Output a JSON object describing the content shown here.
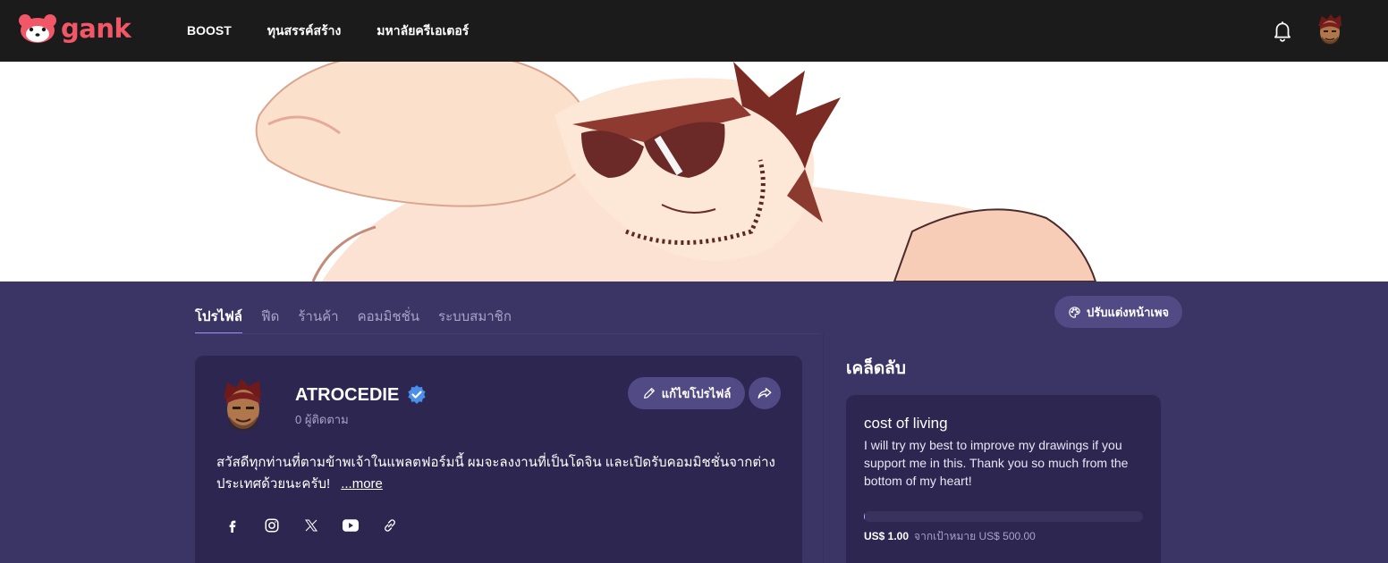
{
  "brand": {
    "name": "gank",
    "color": "#f25767"
  },
  "nav": {
    "items": [
      "BOOST",
      "ทุนสรรค์สร้าง",
      "มหาลัยครีเอเตอร์"
    ]
  },
  "profile_tabs": {
    "items": [
      "โปรไฟล์",
      "ฟีด",
      "ร้านค้า",
      "คอมมิชชั่น",
      "ระบบสมาชิก"
    ],
    "active_index": 0
  },
  "customize_button": {
    "label": "ปรับแต่งหน้าเพจ",
    "icon": "palette-icon"
  },
  "profile": {
    "name": "ATROCEDIE",
    "verified": true,
    "followers": "0 ผู้ติดตาม",
    "edit_label": "แก้ไขโปรไฟล์",
    "bio_line1": "สวัสดีทุกท่านที่ตามข้าพเจ้าในแพลตฟอร์มนี้ ผมจะลงงานที่เป็นโดจิน และเปิดรับคอมมิชชั่นจากต่าง",
    "bio_line2": "ประเทศด้วยนะครับ!",
    "more_label": "...more",
    "socials": [
      "facebook-icon",
      "instagram-icon",
      "x-icon",
      "youtube-icon",
      "link-icon"
    ]
  },
  "secret_section": {
    "title": "เคล็ดลับ",
    "goal": {
      "title": "cost of living",
      "description": "I will try my best to improve my drawings if you support me in this. Thank you so much from the bottom of my heart!",
      "current": "US$ 1.00",
      "target": "จากเป้าหมาย US$ 500.00",
      "progress_fraction": 0.002
    }
  },
  "colors": {
    "accent": "#9d8cf0",
    "page_bg": "#3b3566",
    "card_bg": "#2c2650",
    "topbar_bg": "#1b1b1b"
  }
}
